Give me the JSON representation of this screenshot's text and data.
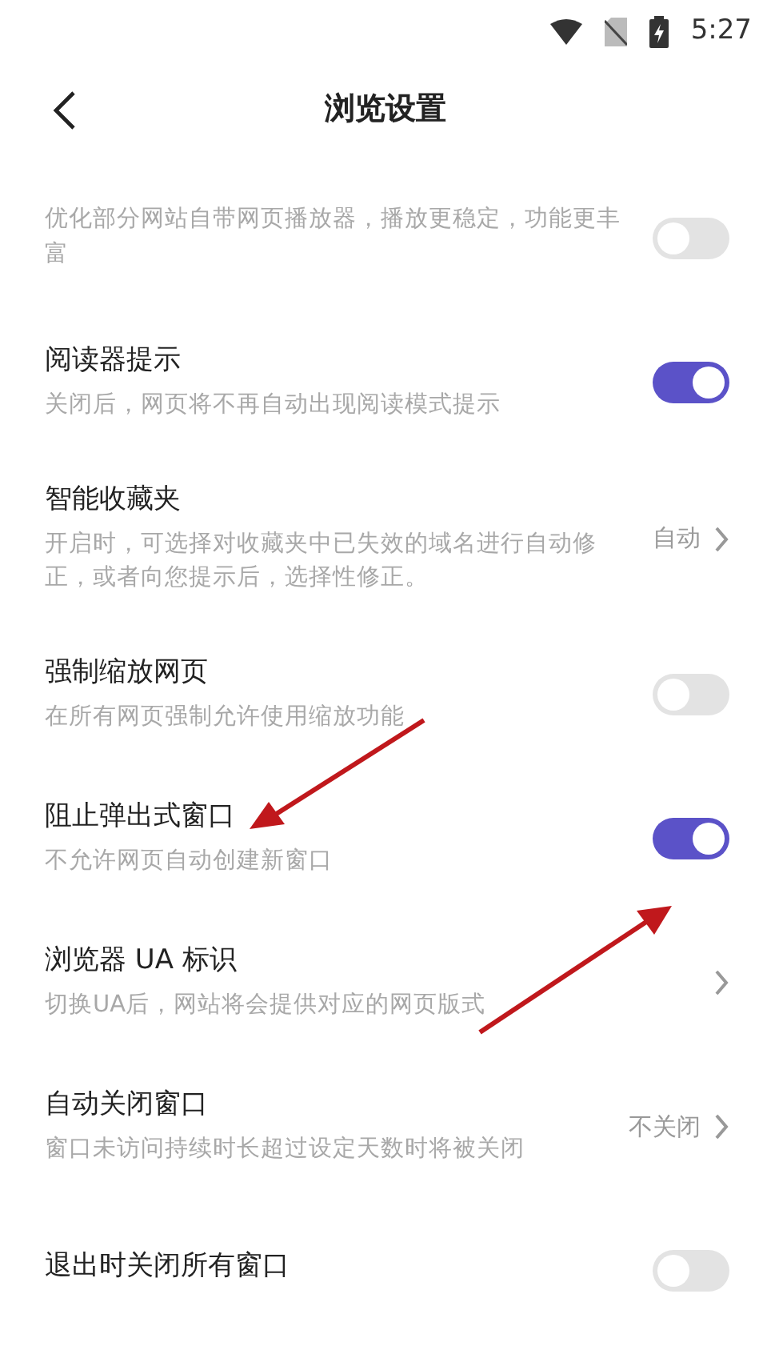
{
  "status_bar": {
    "time": "5:27"
  },
  "header": {
    "title": "浏览设置"
  },
  "settings": [
    {
      "kind": "toggle",
      "description": "优化部分网站自带网页播放器，播放更稳定，功能更丰富",
      "on": false
    },
    {
      "kind": "toggle",
      "title": "阅读器提示",
      "description": "关闭后，网页将不再自动出现阅读模式提示",
      "on": true
    },
    {
      "kind": "value",
      "title": "智能收藏夹",
      "description": "开启时，可选择对收藏夹中已失效的域名进行自动修正，或者向您提示后，选择性修正。",
      "value": "自动"
    },
    {
      "kind": "toggle",
      "title": "强制缩放网页",
      "description": "在所有网页强制允许使用缩放功能",
      "on": false
    },
    {
      "kind": "toggle",
      "title": "阻止弹出式窗口",
      "description": "不允许网页自动创建新窗口",
      "on": true
    },
    {
      "kind": "value",
      "title": "浏览器 UA 标识",
      "description": "切换UA后，网站将会提供对应的网页版式"
    },
    {
      "kind": "value",
      "title": "自动关闭窗口",
      "description": "窗口未访问持续时长超过设定天数时将被关闭",
      "value": "不关闭"
    },
    {
      "kind": "toggle",
      "title": "退出时关闭所有窗口",
      "on": false
    }
  ]
}
